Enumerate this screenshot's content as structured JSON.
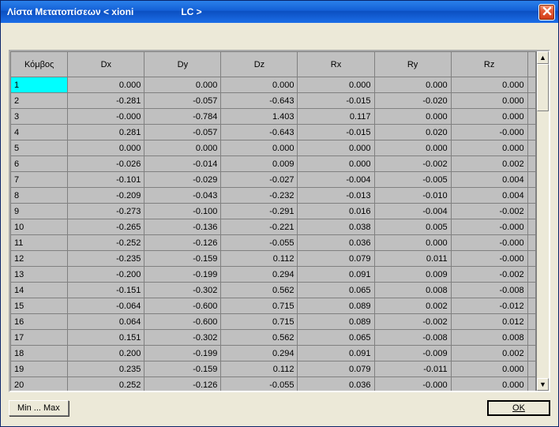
{
  "window": {
    "title_main": "Λίστα Μετατοπίσεων < xioni",
    "title_lc": "LC  >"
  },
  "table": {
    "headers": [
      "Κόμβος",
      "Dx",
      "Dy",
      "Dz",
      "Rx",
      "Ry",
      "Rz"
    ],
    "rows": [
      {
        "node": "1",
        "dx": "0.000",
        "dy": "0.000",
        "dz": "0.000",
        "rx": "0.000",
        "ry": "0.000",
        "rz": "0.000"
      },
      {
        "node": "2",
        "dx": "-0.281",
        "dy": "-0.057",
        "dz": "-0.643",
        "rx": "-0.015",
        "ry": "-0.020",
        "rz": "0.000"
      },
      {
        "node": "3",
        "dx": "-0.000",
        "dy": "-0.784",
        "dz": "1.403",
        "rx": "0.117",
        "ry": "0.000",
        "rz": "0.000"
      },
      {
        "node": "4",
        "dx": "0.281",
        "dy": "-0.057",
        "dz": "-0.643",
        "rx": "-0.015",
        "ry": "0.020",
        "rz": "-0.000"
      },
      {
        "node": "5",
        "dx": "0.000",
        "dy": "0.000",
        "dz": "0.000",
        "rx": "0.000",
        "ry": "0.000",
        "rz": "0.000"
      },
      {
        "node": "6",
        "dx": "-0.026",
        "dy": "-0.014",
        "dz": "0.009",
        "rx": "0.000",
        "ry": "-0.002",
        "rz": "0.002"
      },
      {
        "node": "7",
        "dx": "-0.101",
        "dy": "-0.029",
        "dz": "-0.027",
        "rx": "-0.004",
        "ry": "-0.005",
        "rz": "0.004"
      },
      {
        "node": "8",
        "dx": "-0.209",
        "dy": "-0.043",
        "dz": "-0.232",
        "rx": "-0.013",
        "ry": "-0.010",
        "rz": "0.004"
      },
      {
        "node": "9",
        "dx": "-0.273",
        "dy": "-0.100",
        "dz": "-0.291",
        "rx": "0.016",
        "ry": "-0.004",
        "rz": "-0.002"
      },
      {
        "node": "10",
        "dx": "-0.265",
        "dy": "-0.136",
        "dz": "-0.221",
        "rx": "0.038",
        "ry": "0.005",
        "rz": "-0.000"
      },
      {
        "node": "11",
        "dx": "-0.252",
        "dy": "-0.126",
        "dz": "-0.055",
        "rx": "0.036",
        "ry": "0.000",
        "rz": "-0.000"
      },
      {
        "node": "12",
        "dx": "-0.235",
        "dy": "-0.159",
        "dz": "0.112",
        "rx": "0.079",
        "ry": "0.011",
        "rz": "-0.000"
      },
      {
        "node": "13",
        "dx": "-0.200",
        "dy": "-0.199",
        "dz": "0.294",
        "rx": "0.091",
        "ry": "0.009",
        "rz": "-0.002"
      },
      {
        "node": "14",
        "dx": "-0.151",
        "dy": "-0.302",
        "dz": "0.562",
        "rx": "0.065",
        "ry": "0.008",
        "rz": "-0.008"
      },
      {
        "node": "15",
        "dx": "-0.064",
        "dy": "-0.600",
        "dz": "0.715",
        "rx": "0.089",
        "ry": "0.002",
        "rz": "-0.012"
      },
      {
        "node": "16",
        "dx": "0.064",
        "dy": "-0.600",
        "dz": "0.715",
        "rx": "0.089",
        "ry": "-0.002",
        "rz": "0.012"
      },
      {
        "node": "17",
        "dx": "0.151",
        "dy": "-0.302",
        "dz": "0.562",
        "rx": "0.065",
        "ry": "-0.008",
        "rz": "0.008"
      },
      {
        "node": "18",
        "dx": "0.200",
        "dy": "-0.199",
        "dz": "0.294",
        "rx": "0.091",
        "ry": "-0.009",
        "rz": "0.002"
      },
      {
        "node": "19",
        "dx": "0.235",
        "dy": "-0.159",
        "dz": "0.112",
        "rx": "0.079",
        "ry": "-0.011",
        "rz": "0.000"
      },
      {
        "node": "20",
        "dx": "0.252",
        "dy": "-0.126",
        "dz": "-0.055",
        "rx": "0.036",
        "ry": "-0.000",
        "rz": "0.000"
      }
    ]
  },
  "buttons": {
    "minmax": "Min ... Max",
    "ok": "OK"
  },
  "scroll": {
    "up_glyph": "▲",
    "down_glyph": "▼"
  }
}
